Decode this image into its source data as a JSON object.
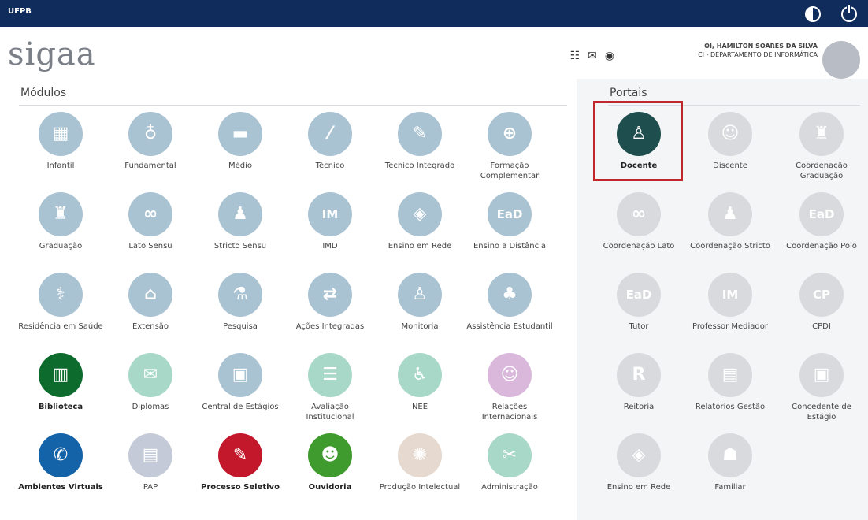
{
  "topbar": {
    "brand": "UFPB"
  },
  "header": {
    "logo": "sigaa",
    "user_name": "OI, HAMILTON SOARES DA SILVA",
    "user_unit": "CI - DEPARTAMENTO DE INFORMÁTICA",
    "icons": [
      "apps-grid-icon",
      "mail-icon",
      "globe-icon"
    ]
  },
  "modulos": {
    "title": "Módulos",
    "items": [
      {
        "label": "Infantil",
        "icon": "blocks-icon",
        "color": "#a9c3d3",
        "active": false
      },
      {
        "label": "Fundamental",
        "icon": "microscope-icon",
        "color": "#a9c3d3",
        "active": false
      },
      {
        "label": "Médio",
        "icon": "book-icon",
        "color": "#a9c3d3",
        "active": false
      },
      {
        "label": "Técnico",
        "icon": "ruler-icon",
        "color": "#a9c3d3",
        "active": false
      },
      {
        "label": "Técnico Integrado",
        "icon": "tools-icon",
        "color": "#a9c3d3",
        "active": false
      },
      {
        "label": "Formação Complementar",
        "icon": "board-icon",
        "color": "#a9c3d3",
        "active": false
      },
      {
        "label": "Graduação",
        "icon": "graduation-cap-icon",
        "color": "#a9c3d3",
        "active": false
      },
      {
        "label": "Lato Sensu",
        "icon": "caps-icon",
        "color": "#a9c3d3",
        "active": false
      },
      {
        "label": "Stricto Sensu",
        "icon": "people-icon",
        "color": "#a9c3d3",
        "active": false
      },
      {
        "label": "IMD",
        "icon": "imd-icon",
        "color": "#a9c3d3",
        "active": false
      },
      {
        "label": "Ensino em Rede",
        "icon": "brazil-map-icon",
        "color": "#a9c3d3",
        "active": false
      },
      {
        "label": "Ensino a Distância",
        "icon": "ead-icon",
        "color": "#a9c3d3",
        "active": false
      },
      {
        "label": "Residência em Saúde",
        "icon": "doctor-icon",
        "color": "#a9c3d3",
        "active": false
      },
      {
        "label": "Extensão",
        "icon": "building-icon",
        "color": "#a9c3d3",
        "active": false
      },
      {
        "label": "Pesquisa",
        "icon": "flask-icon",
        "color": "#a9c3d3",
        "active": false
      },
      {
        "label": "Ações Integradas",
        "icon": "network-icon",
        "color": "#a9c3d3",
        "active": false
      },
      {
        "label": "Monitoria",
        "icon": "teacher-icon",
        "color": "#a9c3d3",
        "active": false
      },
      {
        "label": "Assistência Estudantil",
        "icon": "group-icon",
        "color": "#a9c3d3",
        "active": false
      },
      {
        "label": "Biblioteca",
        "icon": "books-icon",
        "color": "#0e6b2e",
        "active": true
      },
      {
        "label": "Diplomas",
        "icon": "diploma-icon",
        "color": "#a8d8c8",
        "active": false
      },
      {
        "label": "Central de Estágios",
        "icon": "briefcase-icon",
        "color": "#a9c3d3",
        "active": false
      },
      {
        "label": "Avaliação Institucional",
        "icon": "clipboard-icon",
        "color": "#a8d8c8",
        "active": false
      },
      {
        "label": "NEE",
        "icon": "wheelchair-icon",
        "color": "#a8d8c8",
        "active": false
      },
      {
        "label": "Relações Internacionais",
        "icon": "globe-people-icon",
        "color": "#d9b8dc",
        "active": false
      },
      {
        "label": "Ambientes Virtuais",
        "icon": "chat-icon",
        "color": "#1463a8",
        "active": true
      },
      {
        "label": "PAP",
        "icon": "presentation-icon",
        "color": "#c5cad8",
        "active": false
      },
      {
        "label": "Processo Seletivo",
        "icon": "edit-icon",
        "color": "#c3182b",
        "active": true
      },
      {
        "label": "Ouvidoria",
        "icon": "headset-icon",
        "color": "#3f9b2d",
        "active": true
      },
      {
        "label": "Produção Intelectual",
        "icon": "lightbulb-icon",
        "color": "#e6d9cf",
        "active": false
      },
      {
        "label": "Administração",
        "icon": "wrench-icon",
        "color": "#a8d8c8",
        "active": false
      }
    ]
  },
  "portais": {
    "title": "Portais",
    "items": [
      {
        "label": "Docente",
        "icon": "teacher-desk-icon",
        "color": "#1f4e4e",
        "active": true
      },
      {
        "label": "Discente",
        "icon": "student-icon",
        "color": "#d9dadd",
        "active": false
      },
      {
        "label": "Coordenação Graduação",
        "icon": "graduation-cap-icon",
        "color": "#d9dadd",
        "active": false
      },
      {
        "label": "Coordenação Lato",
        "icon": "caps-icon",
        "color": "#d9dadd",
        "active": false
      },
      {
        "label": "Coordenação Stricto",
        "icon": "people-icon",
        "color": "#d9dadd",
        "active": false
      },
      {
        "label": "Coordenação Polo",
        "icon": "ead-icon",
        "color": "#d9dadd",
        "active": false
      },
      {
        "label": "Tutor",
        "icon": "ead-tutor-icon",
        "color": "#d9dadd",
        "active": false
      },
      {
        "label": "Professor Mediador",
        "icon": "imd-icon",
        "color": "#d9dadd",
        "active": false
      },
      {
        "label": "CPDI",
        "icon": "cpdi-icon",
        "color": "#d9dadd",
        "active": false
      },
      {
        "label": "Reitoria",
        "icon": "reitoria-icon",
        "color": "#d9dadd",
        "active": false
      },
      {
        "label": "Relatórios Gestão",
        "icon": "report-icon",
        "color": "#d9dadd",
        "active": false
      },
      {
        "label": "Concedente de Estágio",
        "icon": "briefcase-icon",
        "color": "#d9dadd",
        "active": false
      },
      {
        "label": "Ensino em Rede",
        "icon": "brazil-map-icon",
        "color": "#d9dadd",
        "active": false
      },
      {
        "label": "Familiar",
        "icon": "family-icon",
        "color": "#d9dadd",
        "active": false
      }
    ]
  }
}
